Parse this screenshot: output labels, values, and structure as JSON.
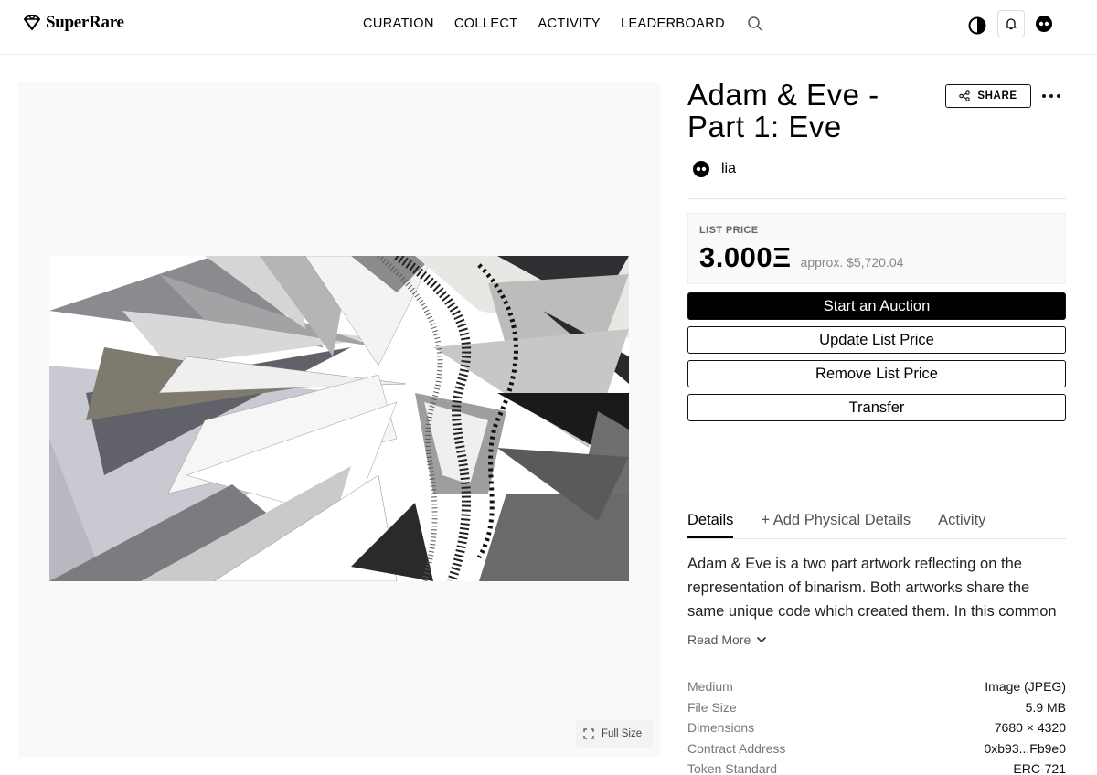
{
  "header": {
    "logo_text": "SuperRare",
    "nav": [
      "CURATION",
      "COLLECT",
      "ACTIVITY",
      "LEADERBOARD"
    ],
    "icons": [
      "search-icon",
      "contrast-icon",
      "bell-icon",
      "avatar-icon"
    ]
  },
  "artwork": {
    "full_size_label": "Full Size"
  },
  "title": "Adam & Eve - Part 1: Eve",
  "share_label": "SHARE",
  "owner": {
    "name": "lia"
  },
  "pricing": {
    "label": "LIST PRICE",
    "eth": "3.000Ξ",
    "usd": "approx. $5,720.04"
  },
  "actions": {
    "start_auction": "Start an Auction",
    "update_price": "Update List Price",
    "remove_price": "Remove List Price",
    "transfer": "Transfer"
  },
  "tabs": {
    "details": "Details",
    "physical": "+ Add Physical Details",
    "activity": "Activity"
  },
  "description": "Adam & Eve is a two part artwork reflecting on the representation of binarism. Both artworks share the same unique code which created them. In this common base, a",
  "read_more": "Read More",
  "specs": [
    {
      "label": "Medium",
      "value": "Image (JPEG)"
    },
    {
      "label": "File Size",
      "value": "5.9 MB"
    },
    {
      "label": "Dimensions",
      "value": "7680 × 4320"
    },
    {
      "label": "Contract Address",
      "value": "0xb93...Fb9e0"
    },
    {
      "label": "Token Standard",
      "value": "ERC-721"
    }
  ]
}
